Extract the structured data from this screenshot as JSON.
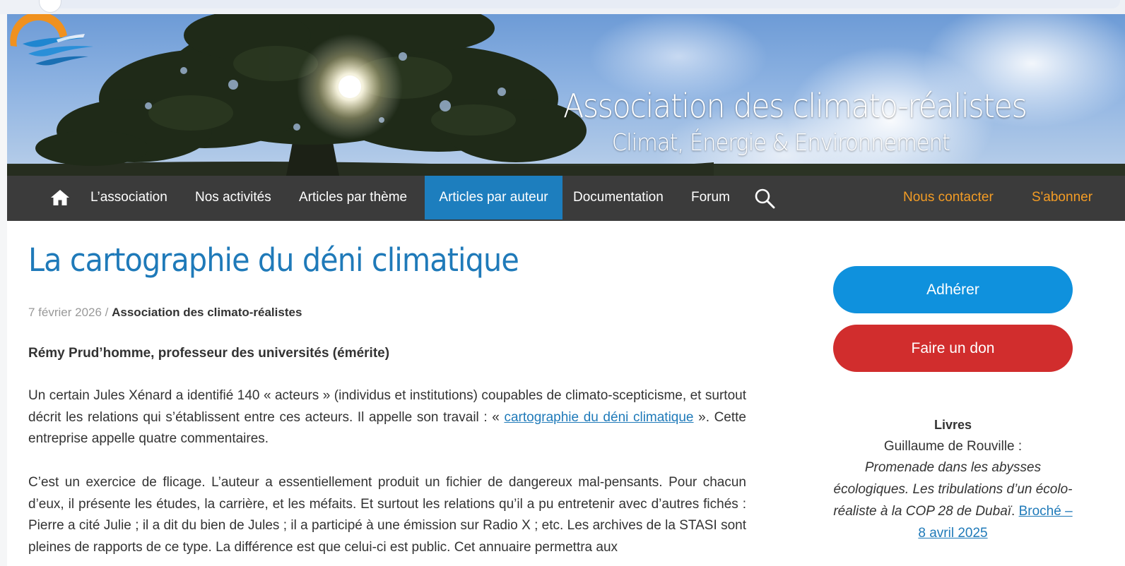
{
  "site": {
    "title": "Association des climato-réalistes",
    "subtitle": "Climat, Énergie & Environnement"
  },
  "nav": {
    "items": [
      {
        "label": "L’association"
      },
      {
        "label": "Nos activités"
      },
      {
        "label": "Articles par thème"
      },
      {
        "label": "Articles par auteur",
        "active": true
      },
      {
        "label": "Documentation"
      },
      {
        "label": "Forum"
      }
    ],
    "contact": "Nous contacter",
    "subscribe": "S'abonner"
  },
  "post": {
    "title": "La cartographie du déni climatique",
    "date": "7 février 2026",
    "separator": " / ",
    "author": "Association des climato-réalistes",
    "byline": "Rémy Prud’homme, professeur des universités (émérite)",
    "p1_before": "Un certain Jules Xénard a identifié 140 « acteurs » (individus et institutions) coupables de climato-scepticisme, et surtout décrit les relations qui s’établissent entre ces acteurs. Il appelle son travail : « ",
    "p1_link": "cartographie du déni climatique",
    "p1_after": " ». Cette entreprise appelle quatre commentaires.",
    "p2": "C’est un exercice de flicage. L’auteur a essentiellement produit un fichier de dangereux mal-pensants. Pour chacun d’eux, il présente les études, la carrière, et les méfaits. Et surtout les relations qu’il a pu entretenir avec d’autres fichés : Pierre a cité Julie ; il a dit du bien de Jules ; il a participé à une émission sur Radio X ; etc. Les archives de la STASI sont pleines de rapports de ce type. La différence est que celui-ci est public. Cet annuaire permettra aux"
  },
  "sidebar": {
    "join_label": "Adhérer",
    "donate_label": "Faire un don",
    "books_heading": "Livres",
    "book_author": "Guillaume de Rouville :",
    "book_title": "Promenade dans les abysses écologiques. Les tribulations d’un écolo-réaliste à la COP 28 de Dubaï",
    "book_link": "Broché – 8 avril 2025"
  },
  "colors": {
    "nav_bg": "#3b3b3b",
    "nav_active": "#1d7ebe",
    "nav_orange": "#f39c25",
    "title_blue": "#1f7ab9",
    "join_blue": "#0f91dd",
    "donate_red": "#d12d2d"
  },
  "icons": {
    "home": "home-icon",
    "search": "search-icon",
    "logo": "sun-wave-logo"
  }
}
